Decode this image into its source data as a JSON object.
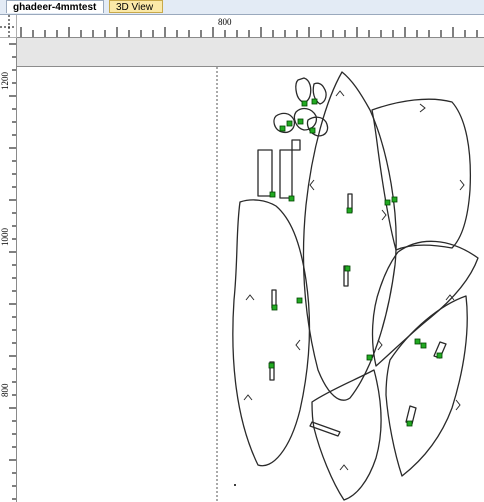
{
  "tabs": [
    {
      "label": "ghadeer-4mmtest",
      "active": true
    },
    {
      "label": "3D View",
      "active": false
    }
  ],
  "ruler": {
    "horizontal_labels": [
      "800"
    ],
    "vertical_labels": [
      "1200",
      "1000",
      "800"
    ]
  },
  "colors": {
    "tab_bar": "#e3ebf5",
    "band": "#e6e6e6",
    "outline": "#2a2a2a",
    "node_green": "#22aa22"
  }
}
